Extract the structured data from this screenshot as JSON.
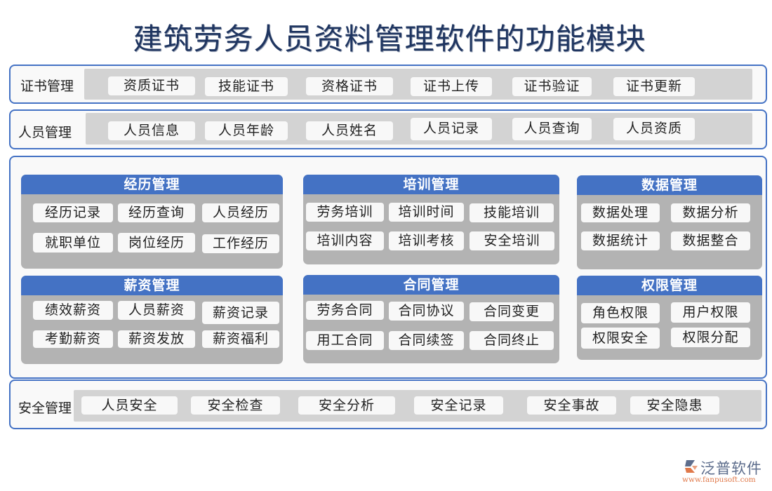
{
  "title": "建筑劳务人员资料管理软件的功能模块",
  "rows": {
    "certificate": {
      "label": "证书管理",
      "items": [
        "资质证书",
        "技能证书",
        "资格证书",
        "证书上传",
        "证书验证",
        "证书更新"
      ]
    },
    "personnel": {
      "label": "人员管理",
      "items": [
        "人员信息",
        "人员年龄",
        "人员姓名",
        "人员记录",
        "人员查询",
        "人员资质"
      ]
    },
    "safety": {
      "label": "安全管理",
      "items": [
        "人员安全",
        "安全检查",
        "安全分析",
        "安全记录",
        "安全事故",
        "安全隐患"
      ]
    }
  },
  "modules": {
    "experience": {
      "title": "经历管理",
      "items": [
        "经历记录",
        "经历查询",
        "人员经历",
        "就职单位",
        "岗位经历",
        "工作经历"
      ]
    },
    "training": {
      "title": "培训管理",
      "items": [
        "劳务培训",
        "培训时间",
        "技能培训",
        "培训内容",
        "培训考核",
        "安全培训"
      ]
    },
    "data": {
      "title": "数据管理",
      "items": [
        "数据处理",
        "数据分析",
        "数据统计",
        "数据整合"
      ]
    },
    "salary": {
      "title": "薪资管理",
      "items": [
        "绩效薪资",
        "人员薪资",
        "薪资记录",
        "考勤薪资",
        "薪资发放",
        "薪资福利"
      ]
    },
    "contract": {
      "title": "合同管理",
      "items": [
        "劳务合同",
        "合同协议",
        "合同变更",
        "用工合同",
        "合同续签",
        "合同终止"
      ]
    },
    "permission": {
      "title": "权限管理",
      "items": [
        "角色权限",
        "用户权限",
        "权限安全",
        "权限分配"
      ]
    }
  },
  "logo": {
    "name": "泛普软件",
    "url": "www.fanpusoft.com"
  },
  "colors": {
    "accent": "#4472c4",
    "title": "#1f3560",
    "track": "#d3d3d3",
    "module_body": "#b3b3b3",
    "logo_url": "#e0794a"
  }
}
